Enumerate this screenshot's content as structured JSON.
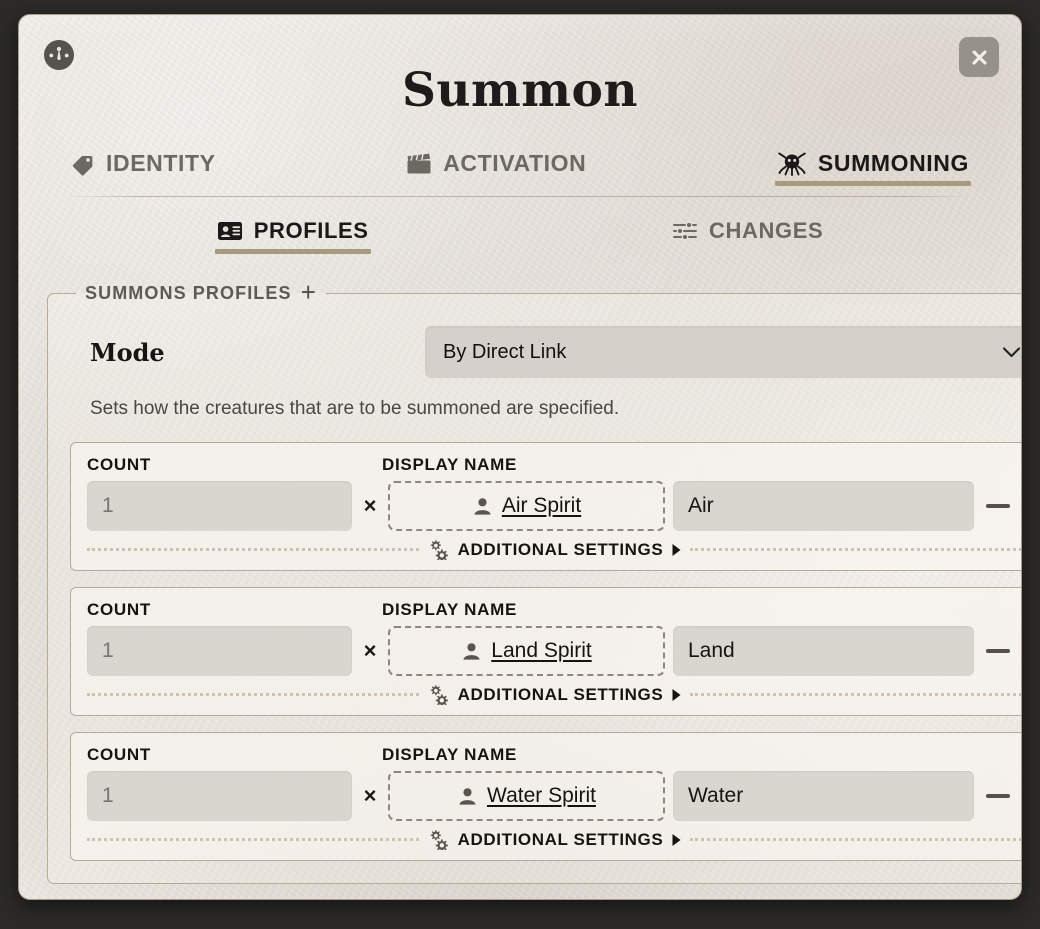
{
  "window": {
    "title": "Summon",
    "app_icon": "gauge-icon",
    "close_label": "×"
  },
  "primary_tabs": [
    {
      "label": "IDENTITY",
      "icon": "tag-icon",
      "active": false
    },
    {
      "label": "ACTIVATION",
      "icon": "clapperboard-icon",
      "active": false
    },
    {
      "label": "SUMMONING",
      "icon": "octopus-icon",
      "active": true
    }
  ],
  "sub_tabs": [
    {
      "label": "PROFILES",
      "icon": "id-card-icon",
      "active": true
    },
    {
      "label": "CHANGES",
      "icon": "sliders-icon",
      "active": false
    }
  ],
  "fieldset": {
    "legend": "SUMMONS PROFILES",
    "add_icon": "plus-icon"
  },
  "mode": {
    "label": "Mode",
    "value": "By Direct Link",
    "options": [
      "By Direct Link"
    ],
    "hint": "Sets how the creatures that are to be summoned are specified."
  },
  "column_labels": {
    "count": "COUNT",
    "display_name": "DISPLAY NAME"
  },
  "row_symbols": {
    "times": "×",
    "additional_settings": "ADDITIONAL SETTINGS",
    "caret": "▶",
    "remove": "—"
  },
  "profiles": [
    {
      "count_placeholder": "1",
      "count_value": "",
      "creature": "Air Spirit",
      "display_name": "Air",
      "display_name_placeholder": "",
      "additional_settings_expanded": false
    },
    {
      "count_placeholder": "1",
      "count_value": "",
      "creature": "Land Spirit",
      "display_name": "Land",
      "display_name_placeholder": "",
      "additional_settings_expanded": false
    },
    {
      "count_placeholder": "1",
      "count_value": "",
      "creature": "Water Spirit",
      "display_name": "Water",
      "display_name_placeholder": "",
      "additional_settings_expanded": false
    }
  ],
  "colors": {
    "accent_underline": "#a89a7f",
    "page_backdrop": "#2c2b2a",
    "panel_border": "#b6ab97",
    "input_fill": "#d9d5cf",
    "text_primary": "#16140f",
    "text_muted": "#6c6962"
  }
}
